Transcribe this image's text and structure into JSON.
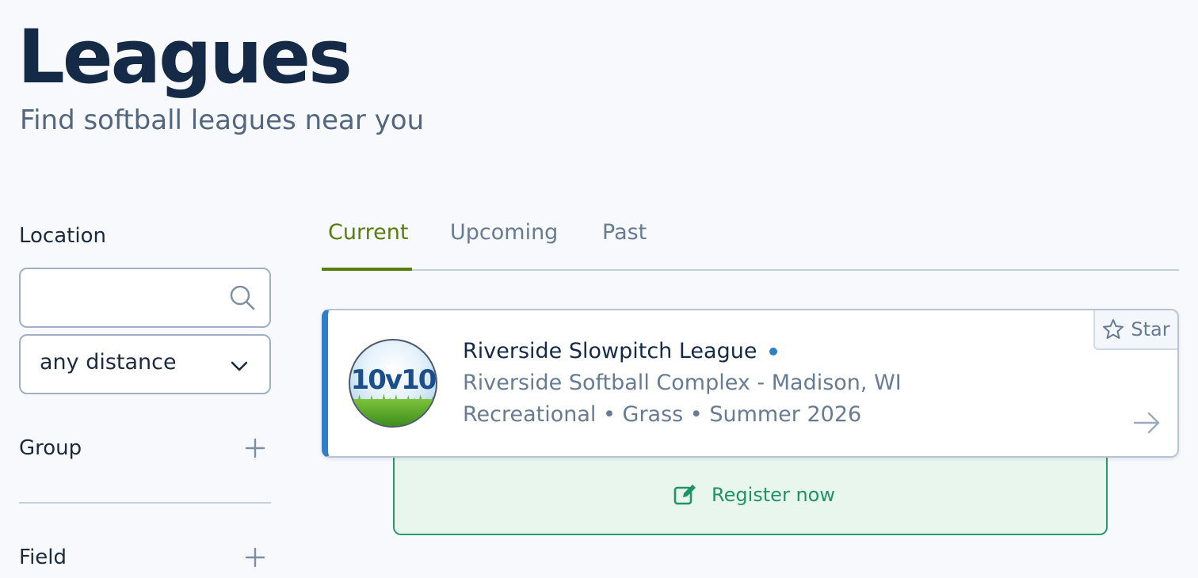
{
  "header": {
    "title": "Leagues",
    "subtitle": "Find softball leagues near you"
  },
  "sidebar": {
    "location_label": "Location",
    "search": {
      "value": "",
      "placeholder": ""
    },
    "distance": {
      "selected": "any distance"
    },
    "filters": [
      {
        "label": "Group"
      },
      {
        "label": "Field"
      }
    ]
  },
  "tabs": [
    {
      "label": "Current",
      "active": true
    },
    {
      "label": "Upcoming",
      "active": false
    },
    {
      "label": "Past",
      "active": false
    }
  ],
  "leagues": [
    {
      "logo_text": "10v10",
      "name": "Riverside Slowpitch League",
      "venue": "Riverside Softball Complex - Madison, WI",
      "meta": "Recreational • Grass • Summer 2026",
      "star_label": "Star",
      "register_label": "Register now"
    }
  ],
  "colors": {
    "accent_tab": "#5a7d12",
    "card_accent": "#2f7fc8",
    "register_green": "#1f9364",
    "title": "#142a47"
  },
  "icons": [
    "search-icon",
    "chevron-down-icon",
    "plus-icon",
    "star-icon",
    "arrow-right-icon",
    "edit-icon"
  ]
}
